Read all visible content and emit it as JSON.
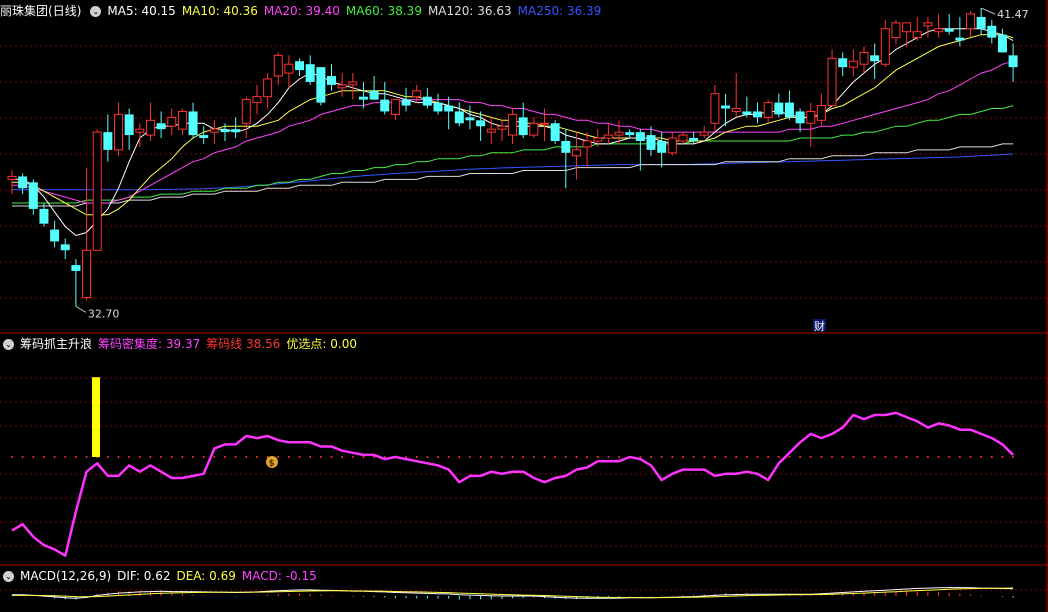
{
  "stock": {
    "name": "丽珠集团",
    "period": "(日线)"
  },
  "ma_legend": [
    {
      "label": "MA5: 40.15",
      "color": "#ffffff"
    },
    {
      "label": "MA10: 40.36",
      "color": "#ffff4a"
    },
    {
      "label": "MA20: 39.40",
      "color": "#ff44ff"
    },
    {
      "label": "MA60: 38.39",
      "color": "#44ee44"
    },
    {
      "label": "MA120: 36.63",
      "color": "#dddddd"
    },
    {
      "label": "MA250: 36.39",
      "color": "#3355ff"
    }
  ],
  "price_high_label": "41.47",
  "price_low_label": "32.70",
  "finance_marker": "财",
  "indicator": {
    "name": "筹码抓主升浪",
    "items": [
      {
        "label": "筹码密集度:",
        "value": "39.37",
        "color": "#ff44ff"
      },
      {
        "label": "筹码线",
        "value": "38.56",
        "color": "#ff3333"
      },
      {
        "label": "优选点:",
        "value": "0.00",
        "color": "#ffff44"
      }
    ],
    "signal_icon": "money-bag-icon",
    "signal_symbol": "$"
  },
  "macd": {
    "name": "MACD(12,26,9)",
    "items": [
      {
        "label": "DIF: 0.62",
        "color": "#ffffff"
      },
      {
        "label": "DEA: 0.69",
        "color": "#ffff44"
      },
      {
        "label": "MACD: -0.15",
        "color": "#ff44ff"
      }
    ]
  },
  "colors": {
    "up": "#ff3232",
    "down": "#54ffff",
    "grid": "#8b0000",
    "border": "#b00000",
    "density": "#ff33ff",
    "chip_line": "#ff3333",
    "bar_signal": "#ffff00"
  },
  "chart_data": {
    "type": "candlestick",
    "price_ylim": [
      31.9,
      42.6
    ],
    "candles": [
      [
        37.0,
        37.3,
        36.5,
        37.1
      ],
      [
        37.1,
        37.2,
        36.5,
        36.7
      ],
      [
        36.9,
        37.0,
        35.8,
        36.0
      ],
      [
        36.0,
        36.2,
        35.4,
        35.5
      ],
      [
        35.3,
        35.6,
        34.7,
        34.9
      ],
      [
        34.8,
        35.0,
        34.3,
        34.6
      ],
      [
        34.1,
        34.3,
        32.7,
        33.9
      ],
      [
        33.0,
        37.4,
        32.9,
        34.6
      ],
      [
        34.6,
        38.7,
        34.6,
        38.6
      ],
      [
        38.6,
        39.2,
        37.6,
        38.0
      ],
      [
        38.0,
        39.6,
        37.8,
        39.2
      ],
      [
        39.2,
        39.4,
        38.0,
        38.5
      ],
      [
        38.6,
        38.9,
        38.1,
        38.7
      ],
      [
        38.5,
        39.6,
        38.3,
        39.0
      ],
      [
        38.9,
        39.3,
        38.4,
        38.7
      ],
      [
        38.8,
        39.4,
        38.5,
        39.1
      ],
      [
        38.7,
        39.4,
        38.5,
        39.3
      ],
      [
        39.3,
        39.6,
        38.4,
        38.5
      ],
      [
        38.5,
        38.8,
        38.2,
        38.4
      ],
      [
        38.6,
        39.0,
        38.2,
        38.7
      ],
      [
        38.7,
        38.9,
        38.3,
        38.6
      ],
      [
        38.7,
        39.1,
        38.4,
        38.6
      ],
      [
        38.9,
        39.8,
        38.4,
        39.7
      ],
      [
        39.6,
        40.2,
        39.2,
        39.8
      ],
      [
        39.8,
        40.6,
        39.4,
        40.4
      ],
      [
        40.5,
        41.3,
        40.2,
        41.2
      ],
      [
        40.6,
        41.2,
        40.1,
        40.9
      ],
      [
        41.0,
        41.1,
        40.5,
        40.7
      ],
      [
        40.9,
        41.2,
        40.2,
        40.3
      ],
      [
        40.8,
        40.8,
        39.5,
        39.6
      ],
      [
        40.5,
        40.9,
        40.0,
        40.2
      ],
      [
        40.1,
        40.6,
        39.8,
        40.2
      ],
      [
        40.2,
        40.6,
        39.7,
        40.3
      ],
      [
        39.8,
        40.3,
        39.4,
        39.7
      ],
      [
        40.0,
        40.5,
        39.7,
        39.7
      ],
      [
        39.7,
        40.3,
        39.2,
        39.3
      ],
      [
        39.2,
        39.7,
        39.0,
        39.7
      ],
      [
        39.7,
        40.1,
        39.3,
        39.5
      ],
      [
        39.8,
        40.2,
        39.6,
        40.0
      ],
      [
        39.8,
        40.1,
        39.4,
        39.5
      ],
      [
        39.6,
        39.9,
        39.2,
        39.3
      ],
      [
        39.5,
        39.8,
        38.7,
        39.3
      ],
      [
        39.3,
        39.6,
        38.8,
        38.9
      ],
      [
        39.1,
        39.5,
        38.7,
        39.0
      ],
      [
        39.0,
        39.3,
        38.3,
        38.8
      ],
      [
        38.6,
        39.1,
        38.2,
        38.7
      ],
      [
        38.7,
        39.0,
        38.3,
        38.8
      ],
      [
        38.5,
        39.4,
        38.2,
        39.2
      ],
      [
        39.1,
        39.6,
        38.4,
        38.5
      ],
      [
        38.5,
        39.1,
        38.4,
        38.9
      ],
      [
        38.9,
        39.4,
        38.3,
        38.9
      ],
      [
        38.9,
        39.0,
        38.2,
        38.3
      ],
      [
        38.3,
        38.7,
        36.7,
        37.9
      ],
      [
        37.8,
        38.6,
        37.0,
        38.0
      ],
      [
        38.1,
        38.6,
        37.4,
        38.3
      ],
      [
        38.3,
        38.7,
        38.1,
        38.4
      ],
      [
        38.4,
        38.9,
        38.2,
        38.5
      ],
      [
        38.5,
        39.0,
        38.2,
        38.6
      ],
      [
        38.6,
        38.7,
        38.4,
        38.5
      ],
      [
        38.6,
        38.7,
        37.3,
        38.3
      ],
      [
        38.5,
        38.8,
        37.8,
        38.0
      ],
      [
        38.3,
        38.6,
        37.4,
        37.9
      ],
      [
        37.9,
        38.6,
        37.8,
        38.4
      ],
      [
        38.3,
        38.6,
        38.2,
        38.5
      ],
      [
        38.4,
        38.6,
        38.2,
        38.3
      ],
      [
        38.5,
        38.8,
        38.4,
        38.6
      ],
      [
        38.9,
        40.2,
        38.6,
        39.9
      ],
      [
        39.5,
        39.9,
        38.8,
        39.4
      ],
      [
        39.3,
        40.6,
        39.1,
        39.4
      ],
      [
        39.3,
        39.8,
        39.1,
        39.2
      ],
      [
        39.3,
        39.6,
        38.9,
        39.1
      ],
      [
        39.1,
        39.7,
        38.9,
        39.6
      ],
      [
        39.6,
        39.9,
        39.1,
        39.2
      ],
      [
        39.6,
        40.0,
        39.0,
        39.1
      ],
      [
        39.3,
        39.4,
        38.6,
        38.9
      ],
      [
        38.9,
        39.6,
        38.1,
        39.3
      ],
      [
        39.0,
        39.9,
        38.8,
        39.5
      ],
      [
        39.5,
        41.4,
        39.5,
        41.1
      ],
      [
        41.1,
        41.3,
        40.5,
        40.8
      ],
      [
        40.8,
        41.4,
        40.5,
        41.0
      ],
      [
        40.9,
        41.5,
        40.6,
        41.3
      ],
      [
        41.2,
        41.6,
        40.4,
        41.0
      ],
      [
        40.9,
        42.4,
        40.8,
        42.1
      ],
      [
        41.8,
        42.4,
        41.6,
        42.3
      ],
      [
        42.0,
        42.3,
        41.5,
        42.3
      ],
      [
        41.8,
        42.5,
        41.7,
        42.0
      ],
      [
        42.2,
        42.5,
        41.8,
        42.3
      ],
      [
        42.0,
        42.6,
        41.8,
        42.1
      ],
      [
        42.1,
        42.6,
        41.9,
        42.0
      ],
      [
        41.8,
        42.5,
        41.5,
        41.7
      ],
      [
        42.1,
        42.7,
        41.8,
        42.6
      ],
      [
        42.5,
        42.8,
        41.9,
        42.1
      ],
      [
        42.2,
        42.4,
        41.6,
        41.8
      ],
      [
        41.9,
        42.1,
        41.3,
        41.3
      ],
      [
        41.2,
        41.6,
        40.3,
        40.8
      ]
    ],
    "ma5": [
      37.0,
      37.0,
      36.8,
      36.4,
      35.9,
      35.4,
      35.1,
      35.2,
      35.6,
      36.0,
      36.7,
      37.6,
      38.4,
      38.7,
      38.8,
      38.8,
      38.9,
      38.9,
      38.9,
      38.7,
      38.7,
      38.6,
      38.7,
      38.9,
      39.2,
      39.6,
      40.1,
      40.4,
      40.6,
      40.5,
      40.3,
      40.2,
      40.1,
      40.0,
      39.9,
      39.9,
      39.8,
      39.7,
      39.6,
      39.6,
      39.6,
      39.5,
      39.4,
      39.2,
      39.1,
      38.9,
      38.8,
      38.8,
      38.8,
      38.8,
      38.8,
      38.7,
      38.5,
      38.4,
      38.3,
      38.2,
      38.2,
      38.3,
      38.4,
      38.4,
      38.4,
      38.3,
      38.2,
      38.2,
      38.2,
      38.3,
      38.6,
      38.9,
      39.1,
      39.2,
      39.2,
      39.3,
      39.3,
      39.2,
      39.1,
      39.1,
      39.2,
      39.5,
      39.9,
      40.3,
      40.6,
      40.9,
      41.1,
      41.4,
      41.6,
      41.8,
      42.0,
      42.1,
      42.1,
      42.1,
      42.1,
      42.1,
      42.0,
      41.9,
      41.7
    ],
    "ma10": [
      36.9,
      36.9,
      36.8,
      36.6,
      36.4,
      36.2,
      36.0,
      35.8,
      35.8,
      35.8,
      36.0,
      36.3,
      36.7,
      37.1,
      37.4,
      37.7,
      38.1,
      38.4,
      38.6,
      38.7,
      38.8,
      38.8,
      38.8,
      38.8,
      38.9,
      39.0,
      39.3,
      39.5,
      39.7,
      39.8,
      39.9,
      40.0,
      40.0,
      40.0,
      40.0,
      40.0,
      39.9,
      39.8,
      39.8,
      39.7,
      39.6,
      39.5,
      39.4,
      39.3,
      39.2,
      39.1,
      39.0,
      39.0,
      38.9,
      38.9,
      38.8,
      38.8,
      38.7,
      38.6,
      38.5,
      38.4,
      38.4,
      38.4,
      38.4,
      38.4,
      38.4,
      38.4,
      38.3,
      38.3,
      38.3,
      38.3,
      38.4,
      38.6,
      38.7,
      38.8,
      38.8,
      38.9,
      39.0,
      39.1,
      39.1,
      39.1,
      39.2,
      39.4,
      39.5,
      39.7,
      39.9,
      40.1,
      40.4,
      40.7,
      40.9,
      41.1,
      41.3,
      41.5,
      41.6,
      41.7,
      41.8,
      41.9,
      41.9,
      41.9,
      41.8
    ],
    "ma20": [
      36.8,
      36.8,
      36.7,
      36.6,
      36.5,
      36.4,
      36.3,
      36.2,
      36.2,
      36.2,
      36.3,
      36.4,
      36.6,
      36.8,
      37.0,
      37.2,
      37.4,
      37.6,
      37.7,
      37.9,
      38.0,
      38.1,
      38.3,
      38.4,
      38.5,
      38.6,
      38.8,
      38.9,
      39.0,
      39.2,
      39.3,
      39.4,
      39.5,
      39.5,
      39.6,
      39.6,
      39.6,
      39.7,
      39.7,
      39.7,
      39.7,
      39.7,
      39.7,
      39.6,
      39.6,
      39.5,
      39.5,
      39.4,
      39.4,
      39.3,
      39.2,
      39.2,
      39.1,
      39.0,
      39.0,
      38.9,
      38.9,
      38.8,
      38.8,
      38.7,
      38.7,
      38.6,
      38.6,
      38.6,
      38.6,
      38.6,
      38.6,
      38.6,
      38.6,
      38.6,
      38.6,
      38.6,
      38.6,
      38.7,
      38.7,
      38.7,
      38.8,
      38.8,
      38.9,
      39.0,
      39.1,
      39.2,
      39.3,
      39.4,
      39.5,
      39.6,
      39.7,
      39.9,
      40.0,
      40.2,
      40.4,
      40.6,
      40.7,
      40.9,
      41.0
    ],
    "ma60": [
      36.2,
      36.2,
      36.2,
      36.2,
      36.2,
      36.2,
      36.2,
      36.3,
      36.3,
      36.3,
      36.3,
      36.4,
      36.4,
      36.4,
      36.5,
      36.5,
      36.5,
      36.6,
      36.6,
      36.6,
      36.7,
      36.7,
      36.7,
      36.8,
      36.8,
      36.9,
      36.9,
      37.0,
      37.0,
      37.1,
      37.2,
      37.2,
      37.3,
      37.3,
      37.4,
      37.4,
      37.5,
      37.5,
      37.6,
      37.6,
      37.7,
      37.7,
      37.7,
      37.8,
      37.8,
      37.9,
      37.9,
      37.9,
      38.0,
      38.0,
      38.0,
      38.1,
      38.1,
      38.1,
      38.1,
      38.2,
      38.2,
      38.2,
      38.2,
      38.2,
      38.2,
      38.2,
      38.2,
      38.2,
      38.3,
      38.3,
      38.3,
      38.3,
      38.3,
      38.3,
      38.3,
      38.3,
      38.3,
      38.3,
      38.4,
      38.4,
      38.4,
      38.4,
      38.5,
      38.5,
      38.6,
      38.6,
      38.7,
      38.8,
      38.8,
      38.9,
      39.0,
      39.0,
      39.1,
      39.2,
      39.2,
      39.3,
      39.4,
      39.4,
      39.5
    ],
    "ma120": [
      36.1,
      36.1,
      36.1,
      36.1,
      36.1,
      36.1,
      36.1,
      36.2,
      36.2,
      36.2,
      36.2,
      36.3,
      36.3,
      36.3,
      36.4,
      36.4,
      36.4,
      36.5,
      36.5,
      36.5,
      36.6,
      36.6,
      36.6,
      36.6,
      36.7,
      36.7,
      36.7,
      36.8,
      36.8,
      36.8,
      36.8,
      36.9,
      36.9,
      36.9,
      36.9,
      37.0,
      37.0,
      37.0,
      37.0,
      37.1,
      37.1,
      37.1,
      37.1,
      37.2,
      37.2,
      37.2,
      37.2,
      37.2,
      37.3,
      37.3,
      37.3,
      37.3,
      37.3,
      37.4,
      37.4,
      37.4,
      37.4,
      37.4,
      37.4,
      37.5,
      37.5,
      37.5,
      37.5,
      37.5,
      37.5,
      37.5,
      37.5,
      37.6,
      37.6,
      37.6,
      37.6,
      37.6,
      37.6,
      37.7,
      37.7,
      37.7,
      37.7,
      37.8,
      37.8,
      37.8,
      37.8,
      37.9,
      37.9,
      37.9,
      37.9,
      38.0,
      38.0,
      38.0,
      38.0,
      38.1,
      38.1,
      38.1,
      38.1,
      38.2,
      38.2
    ],
    "ma250": [
      36.65,
      36.65,
      36.65,
      36.65,
      36.65,
      36.65,
      36.65,
      36.65,
      36.65,
      36.65,
      36.65,
      36.65,
      36.65,
      36.65,
      36.66,
      36.66,
      36.67,
      36.67,
      36.68,
      36.7,
      36.72,
      36.74,
      36.76,
      36.79,
      36.82,
      36.85,
      36.88,
      36.92,
      36.95,
      36.99,
      37.02,
      37.06,
      37.09,
      37.12,
      37.15,
      37.17,
      37.2,
      37.22,
      37.24,
      37.26,
      37.28,
      37.3,
      37.32,
      37.34,
      37.36,
      37.37,
      37.39,
      37.4,
      37.41,
      37.42,
      37.43,
      37.44,
      37.45,
      37.46,
      37.47,
      37.48,
      37.49,
      37.5,
      37.5,
      37.5,
      37.5,
      37.5,
      37.5,
      37.5,
      37.51,
      37.52,
      37.53,
      37.54,
      37.55,
      37.56,
      37.57,
      37.58,
      37.59,
      37.6,
      37.61,
      37.62,
      37.63,
      37.64,
      37.65,
      37.66,
      37.67,
      37.68,
      37.69,
      37.7,
      37.71,
      37.72,
      37.73,
      37.74,
      37.75,
      37.76,
      37.78,
      37.8,
      37.82,
      37.84,
      37.86
    ],
    "indicator_ylim": [
      0,
      100
    ],
    "chip_density": [
      15,
      18,
      12,
      8,
      6,
      3,
      24,
      43,
      47,
      41,
      41,
      46,
      43,
      46,
      43,
      40,
      40,
      41,
      42,
      54,
      56,
      56,
      60,
      59,
      60,
      58,
      57,
      57,
      57,
      55,
      55,
      53,
      52,
      51,
      51,
      49,
      50,
      49,
      48,
      47,
      46,
      44,
      38,
      41,
      41,
      43,
      42,
      43,
      43,
      40,
      38,
      40,
      41,
      44,
      45,
      48,
      48,
      48,
      50,
      49,
      46,
      39,
      42,
      44,
      44,
      44,
      41,
      42,
      42,
      43,
      42,
      39,
      47,
      52,
      57,
      61,
      59,
      61,
      64,
      70,
      68,
      70,
      70,
      71,
      69,
      67,
      64,
      66,
      65,
      63,
      63,
      61,
      59,
      56,
      51
    ],
    "chip_line": 50,
    "signal_bar": {
      "index": 12,
      "from": 50,
      "to": 88
    },
    "macd_ylim": [
      -1.2,
      1.2
    ],
    "dif": [
      0.1,
      0.1,
      0.05,
      0,
      -0.08,
      -0.15,
      -0.2,
      -0.12,
      0.05,
      0.15,
      0.25,
      0.3,
      0.35,
      0.38,
      0.4,
      0.38,
      0.38,
      0.36,
      0.35,
      0.33,
      0.32,
      0.3,
      0.32,
      0.35,
      0.4,
      0.45,
      0.5,
      0.52,
      0.52,
      0.5,
      0.48,
      0.45,
      0.42,
      0.4,
      0.38,
      0.35,
      0.3,
      0.28,
      0.25,
      0.22,
      0.2,
      0.18,
      0.1,
      0.08,
      0.05,
      0.02,
      0.0,
      0.0,
      0.0,
      0.0,
      -0.05,
      -0.1,
      -0.15,
      -0.18,
      -0.2,
      -0.2,
      -0.2,
      -0.18,
      -0.15,
      -0.15,
      -0.15,
      -0.12,
      -0.1,
      -0.08,
      -0.05,
      0.0,
      0.05,
      0.1,
      0.12,
      0.15,
      0.15,
      0.15,
      0.15,
      0.15,
      0.15,
      0.15,
      0.2,
      0.25,
      0.3,
      0.35,
      0.4,
      0.45,
      0.5,
      0.55,
      0.6,
      0.65,
      0.68,
      0.7,
      0.72,
      0.72,
      0.7,
      0.68,
      0.66,
      0.64,
      0.62
    ],
    "dea": [
      0.05,
      0.05,
      0.05,
      0.04,
      0.02,
      -0.01,
      -0.05,
      -0.07,
      -0.05,
      -0.01,
      0.04,
      0.09,
      0.14,
      0.19,
      0.23,
      0.26,
      0.28,
      0.3,
      0.31,
      0.32,
      0.32,
      0.32,
      0.32,
      0.33,
      0.34,
      0.36,
      0.39,
      0.41,
      0.43,
      0.44,
      0.45,
      0.45,
      0.44,
      0.43,
      0.42,
      0.41,
      0.39,
      0.37,
      0.35,
      0.33,
      0.31,
      0.29,
      0.25,
      0.22,
      0.19,
      0.16,
      0.13,
      0.1,
      0.08,
      0.06,
      0.04,
      0.01,
      -0.02,
      -0.05,
      -0.08,
      -0.1,
      -0.12,
      -0.13,
      -0.13,
      -0.14,
      -0.14,
      -0.14,
      -0.13,
      -0.12,
      -0.11,
      -0.09,
      -0.06,
      -0.03,
      0.0,
      0.03,
      0.05,
      0.07,
      0.09,
      0.1,
      0.11,
      0.12,
      0.13,
      0.15,
      0.18,
      0.21,
      0.25,
      0.29,
      0.33,
      0.37,
      0.42,
      0.46,
      0.5,
      0.54,
      0.58,
      0.61,
      0.63,
      0.65,
      0.66,
      0.67,
      0.69
    ]
  }
}
